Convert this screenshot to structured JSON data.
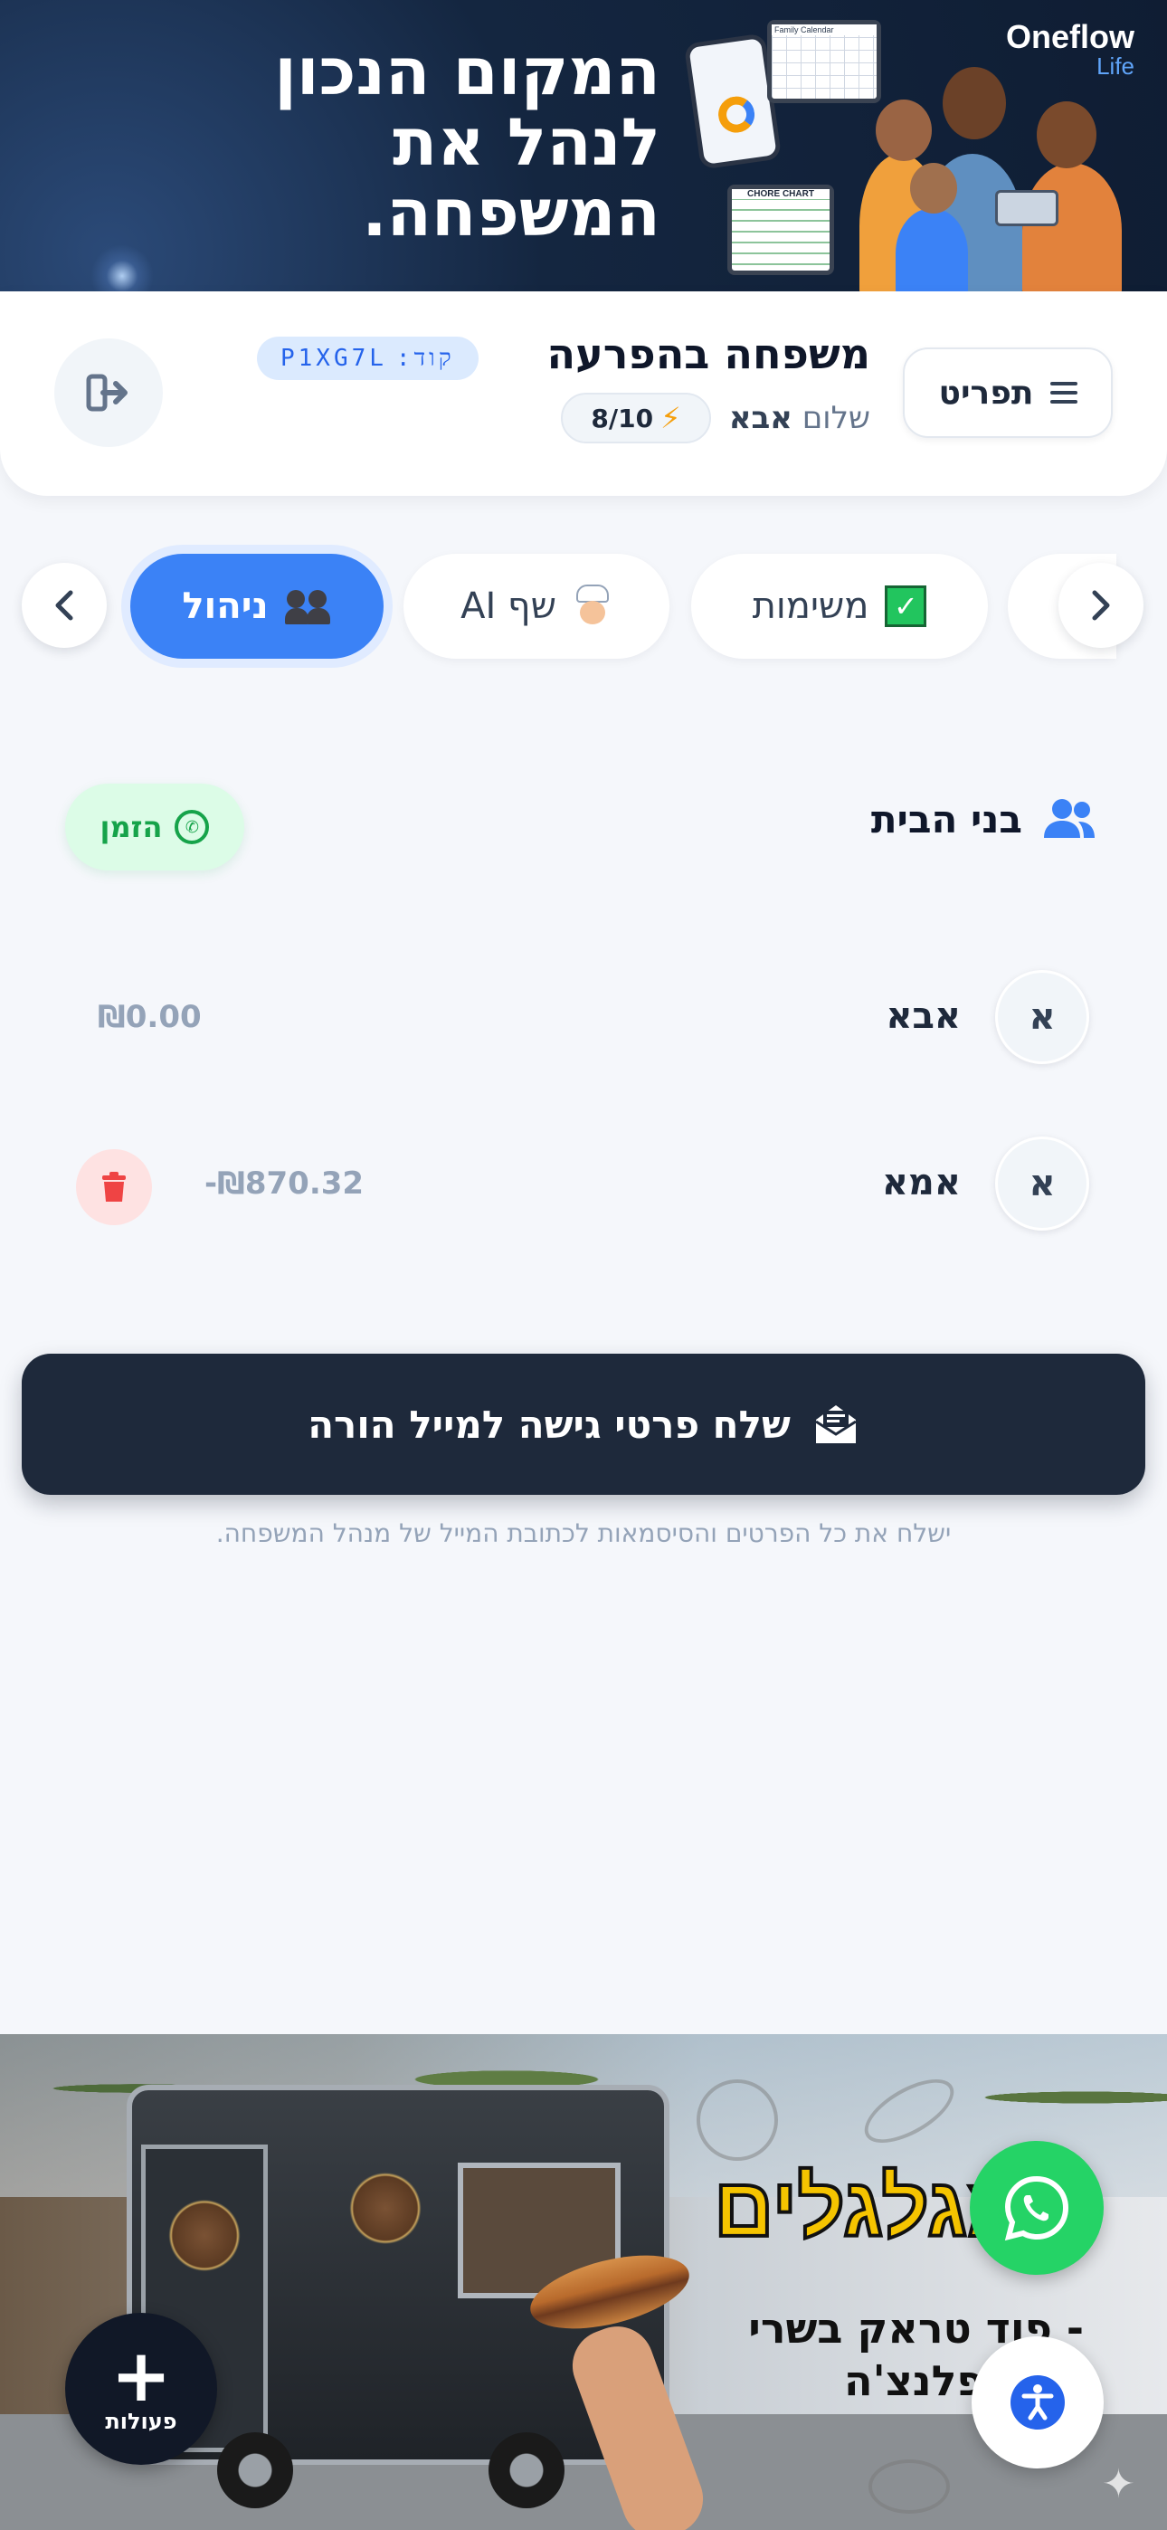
{
  "top_banner": {
    "headline_line1": "המקום הנכון",
    "headline_line2": "לנהל את",
    "headline_line3": "המשפחה.",
    "brand_name": "Oneflow",
    "brand_sub": "Life",
    "chore_chart_label": "CHORE CHART",
    "calendar_label": "Family Calendar"
  },
  "header": {
    "menu_label": "תפריט",
    "family_name": "משפחה בהפרעה",
    "code_label": "קוד:",
    "code_value": "P1XG7L",
    "greeting_prefix": "שלום",
    "user_name": "אבא",
    "points": "8/10"
  },
  "tabs": {
    "tasks": "משימות",
    "chef_ai": "שף AI",
    "manage": "ניהול",
    "active": "ניהול"
  },
  "household": {
    "title": "בני הבית",
    "invite_label": "הזמן",
    "members": [
      {
        "initial": "א",
        "name": "אבא",
        "balance": "₪0.00"
      },
      {
        "initial": "א",
        "name": "אמא",
        "balance": "-₪870.32"
      }
    ]
  },
  "send_access": {
    "button_label": "שלח פרטי גישה למייל הורה",
    "helper_text": "ישלח את כל הפרטים והסיסמאות לכתובת המייל של מנהל המשפחה."
  },
  "ad": {
    "title": "המגלגלים",
    "subtitle_line1": "- פוד טראק בשרי",
    "subtitle_line2": "של הפלנצ'ה"
  },
  "fab": {
    "actions_label": "פעולות"
  },
  "colors": {
    "accent": "#3b82f6",
    "dark": "#1e293b",
    "whatsapp": "#25d366",
    "danger": "#ef4444"
  },
  "icons": [
    "hamburger-icon",
    "logout-icon",
    "chevron-left-icon",
    "chevron-right-icon",
    "checkbox-icon",
    "chef-icon",
    "people-icon",
    "users-icon",
    "whatsapp-icon",
    "trash-icon",
    "envelope-icon",
    "plus-icon",
    "accessibility-icon",
    "bolt-icon"
  ]
}
